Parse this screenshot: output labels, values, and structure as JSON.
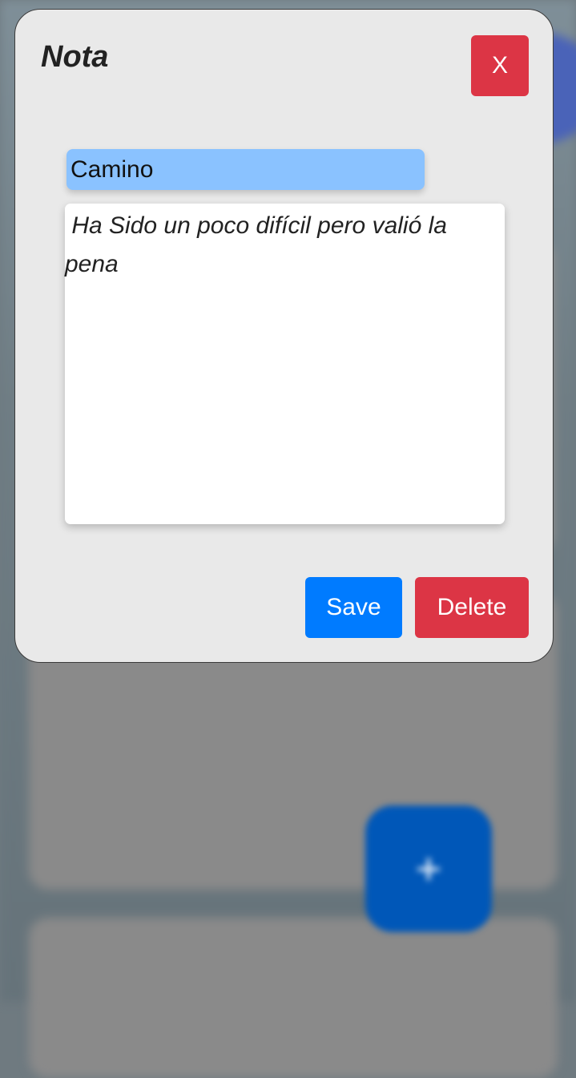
{
  "modal": {
    "title": "Nota",
    "close_label": "X",
    "note_title_value": "Camino",
    "note_content_value": " Ha Sido un poco difícil pero valió la pena",
    "save_label": "Save",
    "delete_label": "Delete"
  },
  "colors": {
    "primary": "#007bff",
    "danger": "#dc3545",
    "title_input_bg": "#8ac2ff",
    "modal_bg": "#e9e9e9"
  },
  "fab": {
    "icon": "plus-icon",
    "glyph": "+"
  }
}
